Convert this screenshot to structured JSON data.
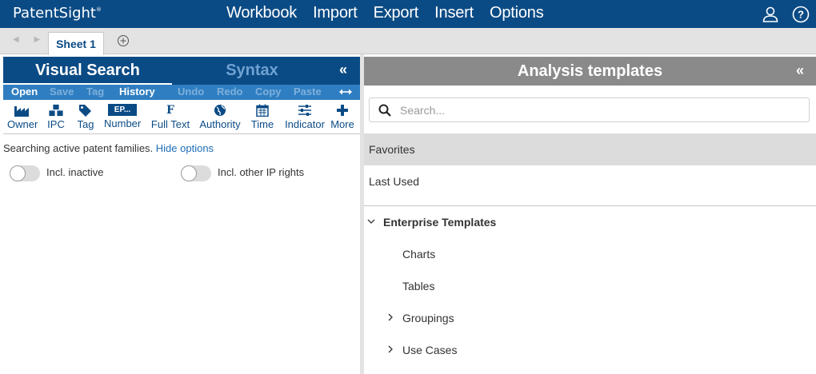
{
  "app": {
    "logo": "PatentSight",
    "logo_mark": "®",
    "menu": [
      "Workbook",
      "Import",
      "Export",
      "Insert",
      "Options"
    ]
  },
  "sheets": {
    "nav_arrows": "◀ ▶",
    "active": "Sheet 1"
  },
  "left_panel": {
    "tab_visual": "Visual Search",
    "tab_syntax": "Syntax",
    "collapse": "«",
    "actions": {
      "open": "Open",
      "save": "Save",
      "tag": "Tag",
      "history": "History",
      "undo": "Undo",
      "redo": "Redo",
      "copy": "Copy",
      "paste": "Paste"
    },
    "tools": {
      "owner": "Owner",
      "ipc": "IPC",
      "tag": "Tag",
      "number": "Number",
      "number_badge": "EP...",
      "fulltext": "Full Text",
      "fulltext_glyph": "F",
      "authority": "Authority",
      "time": "Time",
      "indicator": "Indicator",
      "more": "More"
    },
    "status_text": "Searching active patent families.",
    "hide_options": "Hide options",
    "toggle_inactive": "Incl. inactive",
    "toggle_other_ip": "Incl. other IP rights"
  },
  "right_panel": {
    "title": "Analysis templates",
    "collapse": "«",
    "search_placeholder": "Search...",
    "favorites": "Favorites",
    "last_used": "Last Used",
    "enterprise": "Enterprise Templates",
    "charts": "Charts",
    "tables": "Tables",
    "groupings": "Groupings",
    "use_cases": "Use Cases"
  },
  "colors": {
    "brand": "#0b4b85",
    "accent": "#2f7ec1",
    "panel_header": "#8a8a8a"
  }
}
